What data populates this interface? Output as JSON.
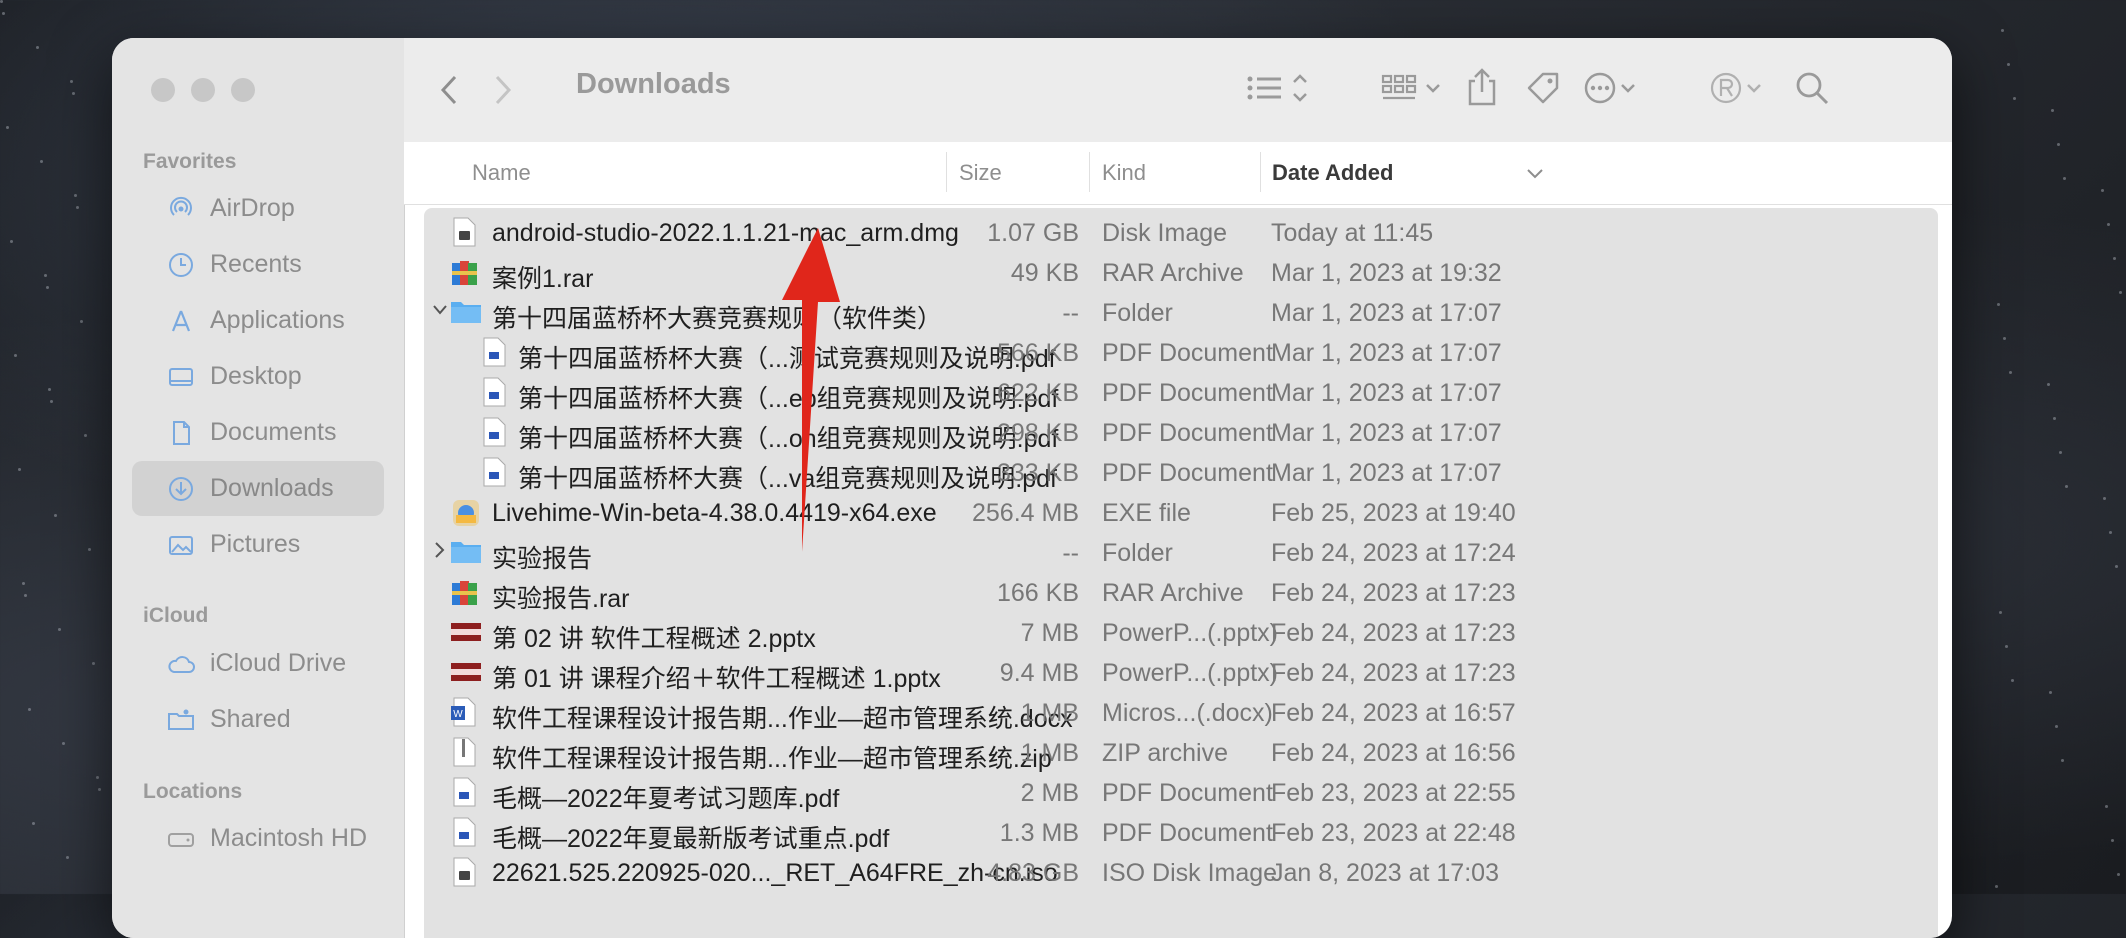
{
  "window": {
    "title": "Downloads"
  },
  "sidebar": {
    "sections": [
      {
        "title": "Favorites",
        "items": [
          {
            "label": "AirDrop",
            "icon": "airdrop-icon"
          },
          {
            "label": "Recents",
            "icon": "clock-icon"
          },
          {
            "label": "Applications",
            "icon": "applications-icon"
          },
          {
            "label": "Desktop",
            "icon": "desktop-icon"
          },
          {
            "label": "Documents",
            "icon": "document-icon"
          },
          {
            "label": "Downloads",
            "icon": "download-icon",
            "selected": true
          },
          {
            "label": "Pictures",
            "icon": "photo-icon"
          }
        ]
      },
      {
        "title": "iCloud",
        "items": [
          {
            "label": "iCloud Drive",
            "icon": "cloud-icon"
          },
          {
            "label": "Shared",
            "icon": "shared-folder-icon"
          }
        ]
      },
      {
        "title": "Locations",
        "items": [
          {
            "label": "Macintosh HD",
            "icon": "hard-drive-icon"
          }
        ]
      }
    ]
  },
  "columns": {
    "name": "Name",
    "size": "Size",
    "kind": "Kind",
    "date": "Date Added"
  },
  "rows": [
    {
      "name": "android-studio-2022.1.1.21-mac_arm.dmg",
      "size": "1.07 GB",
      "kind": "Disk Image",
      "date": "Today at 11:45",
      "type": "dmg"
    },
    {
      "name": "案例1.rar",
      "size": "49 KB",
      "kind": "RAR Archive",
      "date": "Mar 1, 2023 at 19:32",
      "type": "rar"
    },
    {
      "name": "第十四届蓝桥杯大赛竞赛规则（软件类）",
      "size": "--",
      "kind": "Folder",
      "date": "Mar 1, 2023 at 17:07",
      "type": "folder",
      "expanded": true
    },
    {
      "name": "第十四届蓝桥杯大赛（...测试竞赛规则及说明.pdf",
      "size": "566 KB",
      "kind": "PDF Document",
      "date": "Mar 1, 2023 at 17:07",
      "type": "pdf",
      "indent": true
    },
    {
      "name": "第十四届蓝桥杯大赛（...eb组竞赛规则及说明.pdf",
      "size": "622 KB",
      "kind": "PDF Document",
      "date": "Mar 1, 2023 at 17:07",
      "type": "pdf",
      "indent": true
    },
    {
      "name": "第十四届蓝桥杯大赛（...on组竞赛规则及说明.pdf",
      "size": "298 KB",
      "kind": "PDF Document",
      "date": "Mar 1, 2023 at 17:07",
      "type": "pdf",
      "indent": true
    },
    {
      "name": "第十四届蓝桥杯大赛（...va组竞赛规则及说明.pdf",
      "size": "333 KB",
      "kind": "PDF Document",
      "date": "Mar 1, 2023 at 17:07",
      "type": "pdf",
      "indent": true
    },
    {
      "name": "Livehime-Win-beta-4.38.0.4419-x64.exe",
      "size": "256.4 MB",
      "kind": "EXE file",
      "date": "Feb 25, 2023 at 19:40",
      "type": "exe"
    },
    {
      "name": "实验报告",
      "size": "--",
      "kind": "Folder",
      "date": "Feb 24, 2023 at 17:24",
      "type": "folder",
      "expanded": false
    },
    {
      "name": "实验报告.rar",
      "size": "166 KB",
      "kind": "RAR Archive",
      "date": "Feb 24, 2023 at 17:23",
      "type": "rar"
    },
    {
      "name": "第 02 讲 软件工程概述 2.pptx",
      "size": "7 MB",
      "kind": "PowerP...(.pptx)",
      "date": "Feb 24, 2023 at 17:23",
      "type": "pptx"
    },
    {
      "name": "第 01 讲 课程介绍＋软件工程概述 1.pptx",
      "size": "9.4 MB",
      "kind": "PowerP...(.pptx)",
      "date": "Feb 24, 2023 at 17:23",
      "type": "pptx"
    },
    {
      "name": "软件工程课程设计报告期...作业—超市管理系统.docx",
      "size": "1 MB",
      "kind": "Micros...(.docx)",
      "date": "Feb 24, 2023 at 16:57",
      "type": "docx"
    },
    {
      "name": "软件工程课程设计报告期...作业—超市管理系统.zip",
      "size": "1 MB",
      "kind": "ZIP archive",
      "date": "Feb 24, 2023 at 16:56",
      "type": "zip"
    },
    {
      "name": "毛概—2022年夏考试习题库.pdf",
      "size": "2 MB",
      "kind": "PDF Document",
      "date": "Feb 23, 2023 at 22:55",
      "type": "pdf"
    },
    {
      "name": "毛概—2022年夏最新版考试重点.pdf",
      "size": "1.3 MB",
      "kind": "PDF Document",
      "date": "Feb 23, 2023 at 22:48",
      "type": "pdf"
    },
    {
      "name": "22621.525.220925-020..._RET_A64FRE_zh-cn.iso",
      "size": "4.83 GB",
      "kind": "ISO Disk Image",
      "date": "Jan 8, 2023 at 17:03",
      "type": "iso"
    }
  ],
  "annotation": {
    "color": "#e0261b"
  },
  "colors": {
    "folder": "#5aaef0",
    "sidebar_bg": "#e4e4e4",
    "list_bg": "#e2e2e2"
  }
}
